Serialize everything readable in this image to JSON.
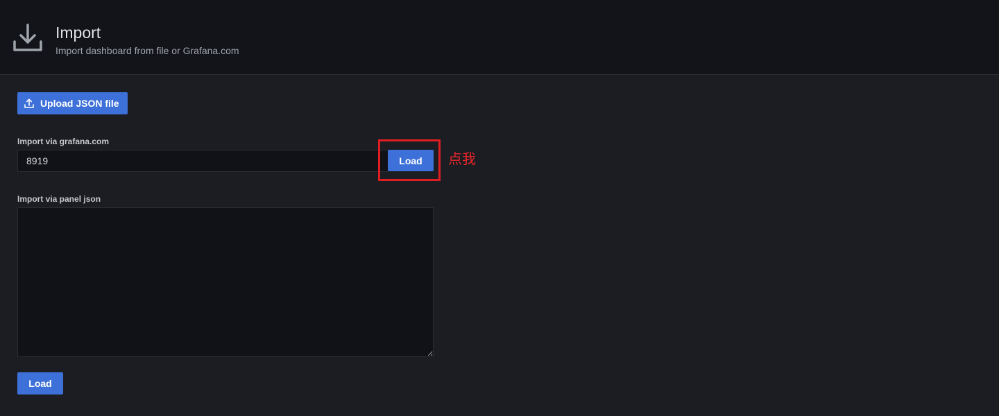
{
  "header": {
    "title": "Import",
    "subtitle": "Import dashboard from file or Grafana.com",
    "icon": "download-icon"
  },
  "upload": {
    "label": "Upload JSON file",
    "icon": "upload-icon"
  },
  "grafana_import": {
    "label": "Import via grafana.com",
    "value": "8919",
    "load_label": "Load"
  },
  "annotation": {
    "text": "点我",
    "color": "#e8262b"
  },
  "panel_json": {
    "label": "Import via panel json",
    "value": "",
    "load_label": "Load"
  },
  "colors": {
    "accent": "#3d71d9",
    "header_bg": "#131419",
    "page_bg": "#1b1d22",
    "highlight": "#e01e22"
  }
}
